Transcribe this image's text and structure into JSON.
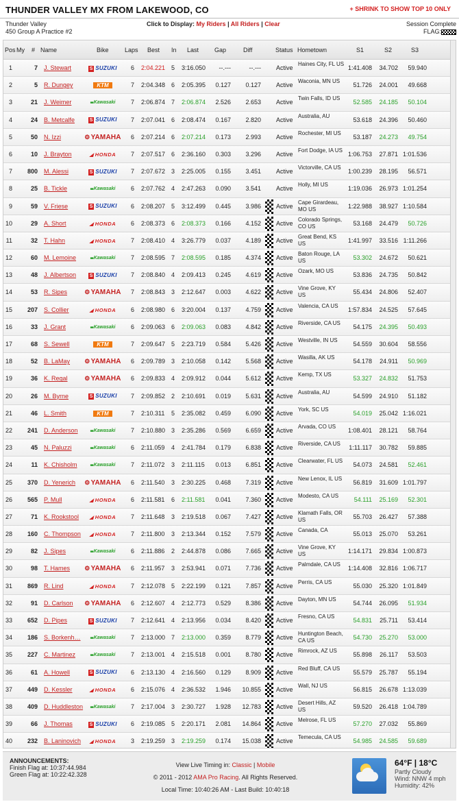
{
  "header": {
    "title": "THUNDER VALLEY MX FROM LAKEWOOD, CO",
    "shrink_label": "+ SHRINK TO SHOW TOP 10 ONLY"
  },
  "info": {
    "track": "Thunder Valley",
    "session_name": "450 Group A Practice #2",
    "display_prompt": "Click to Display:",
    "link_my_riders": "My Riders",
    "separator": " | ",
    "link_all_riders": "All Riders",
    "link_clear": "Clear",
    "session_status": "Session Complete",
    "flag_label": "FLAG:"
  },
  "columns": {
    "pos": "Pos",
    "my": "My",
    "num": "#",
    "name": "Name",
    "bike": "Bike",
    "laps": "Laps",
    "best": "Best",
    "in": "In",
    "last": "Last",
    "gap": "Gap",
    "diff": "Diff",
    "status": "Status",
    "hometown": "Hometown",
    "s1": "S1",
    "s2": "S2",
    "s3": "S3"
  },
  "colors": {
    "red": "#d32020",
    "green": "#2aa02a",
    "suzuki_blue": "#1a3fa8",
    "ktm_orange": "#f07a10"
  },
  "riders": [
    {
      "pos": "1",
      "num": "7",
      "name": "J. Stewart",
      "bike": "suzuki",
      "laps": "6",
      "best": "2:04.221",
      "in": "5",
      "last": "3:16.050",
      "gap": "--.---",
      "diff": "--.---",
      "status": "Active",
      "hometown": "Haines City, FL US",
      "s1": "1:41.408",
      "s2": "34.702",
      "s3": "59.940",
      "best_red": true
    },
    {
      "pos": "2",
      "num": "5",
      "name": "R. Dungey",
      "bike": "ktm",
      "laps": "7",
      "best": "2:04.348",
      "in": "6",
      "last": "2:05.395",
      "gap": "0.127",
      "diff": "0.127",
      "status": "Active",
      "hometown": "Waconia, MN US",
      "s1": "51.726",
      "s2": "24.001",
      "s3": "49.668"
    },
    {
      "pos": "3",
      "num": "21",
      "name": "J. Weimer",
      "bike": "kawasaki",
      "laps": "7",
      "best": "2:06.874",
      "in": "7",
      "last": "2:06.874",
      "gap": "2.526",
      "diff": "2.653",
      "status": "Active",
      "hometown": "Twin Falls, ID US",
      "s1": "52.585",
      "s2": "24.185",
      "s3": "50.104",
      "last_green": true,
      "s1g": true,
      "s2g": true,
      "s3g": true
    },
    {
      "pos": "4",
      "num": "24",
      "name": "B. Metcalfe",
      "bike": "suzuki",
      "laps": "7",
      "best": "2:07.041",
      "in": "6",
      "last": "2:08.474",
      "gap": "0.167",
      "diff": "2.820",
      "status": "Active",
      "hometown": "Australia, AU",
      "s1": "53.618",
      "s2": "24.396",
      "s3": "50.460"
    },
    {
      "pos": "5",
      "num": "50",
      "name": "N. Izzi",
      "bike": "yamaha",
      "laps": "6",
      "best": "2:07.214",
      "in": "6",
      "last": "2:07.214",
      "gap": "0.173",
      "diff": "2.993",
      "status": "Active",
      "hometown": "Rochester, MI US",
      "s1": "53.187",
      "s2": "24.273",
      "s3": "49.754",
      "last_green": true,
      "s2g": true,
      "s3g": true
    },
    {
      "pos": "6",
      "num": "10",
      "name": "J. Brayton",
      "bike": "honda",
      "laps": "7",
      "best": "2:07.517",
      "in": "6",
      "last": "2:36.160",
      "gap": "0.303",
      "diff": "3.296",
      "status": "Active",
      "hometown": "Fort Dodge, IA US",
      "s1": "1:06.753",
      "s2": "27.871",
      "s3": "1:01.536"
    },
    {
      "pos": "7",
      "num": "800",
      "name": "M. Alessi",
      "bike": "suzuki",
      "laps": "7",
      "best": "2:07.672",
      "in": "3",
      "last": "2:25.005",
      "gap": "0.155",
      "diff": "3.451",
      "status": "Active",
      "hometown": "Victorville, CA US",
      "s1": "1:00.239",
      "s2": "28.195",
      "s3": "56.571"
    },
    {
      "pos": "8",
      "num": "25",
      "name": "B. Tickle",
      "bike": "kawasaki",
      "laps": "6",
      "best": "2:07.762",
      "in": "4",
      "last": "2:47.263",
      "gap": "0.090",
      "diff": "3.541",
      "status": "Active",
      "hometown": "Holly, MI US",
      "s1": "1:19.036",
      "s2": "26.973",
      "s3": "1:01.254"
    },
    {
      "pos": "9",
      "num": "59",
      "name": "V. Friese",
      "bike": "suzuki",
      "laps": "6",
      "best": "2:08.207",
      "in": "5",
      "last": "3:12.499",
      "gap": "0.445",
      "diff": "3.986",
      "status": "Active",
      "hometown": "Cape Girardeau, MO US",
      "s1": "1:22.988",
      "s2": "38.927",
      "s3": "1:10.584",
      "chk": true
    },
    {
      "pos": "10",
      "num": "29",
      "name": "A. Short",
      "bike": "honda",
      "laps": "6",
      "best": "2:08.373",
      "in": "6",
      "last": "2:08.373",
      "gap": "0.166",
      "diff": "4.152",
      "status": "Active",
      "hometown": "Colorado Springs, CO US",
      "s1": "53.168",
      "s2": "24.479",
      "s3": "50.726",
      "last_green": true,
      "s3g": true,
      "chk": true
    },
    {
      "pos": "11",
      "num": "32",
      "name": "T. Hahn",
      "bike": "honda",
      "laps": "7",
      "best": "2:08.410",
      "in": "4",
      "last": "3:26.779",
      "gap": "0.037",
      "diff": "4.189",
      "status": "Active",
      "hometown": "Great Bend, KS US",
      "s1": "1:41.997",
      "s2": "33.516",
      "s3": "1:11.266",
      "chk": true
    },
    {
      "pos": "12",
      "num": "60",
      "name": "M. Lemoine",
      "bike": "kawasaki",
      "laps": "7",
      "best": "2:08.595",
      "in": "7",
      "last": "2:08.595",
      "gap": "0.185",
      "diff": "4.374",
      "status": "Active",
      "hometown": "Baton Rouge, LA US",
      "s1": "53.302",
      "s2": "24.672",
      "s3": "50.621",
      "last_green": true,
      "s1g": true,
      "chk": true
    },
    {
      "pos": "13",
      "num": "48",
      "name": "J. Albertson",
      "bike": "suzuki",
      "laps": "7",
      "best": "2:08.840",
      "in": "4",
      "last": "2:09.413",
      "gap": "0.245",
      "diff": "4.619",
      "status": "Active",
      "hometown": "Ozark, MO US",
      "s1": "53.836",
      "s2": "24.735",
      "s3": "50.842",
      "chk": true
    },
    {
      "pos": "14",
      "num": "53",
      "name": "R. Sipes",
      "bike": "yamaha",
      "laps": "7",
      "best": "2:08.843",
      "in": "3",
      "last": "2:12.647",
      "gap": "0.003",
      "diff": "4.622",
      "status": "Active",
      "hometown": "Vine Grove, KY US",
      "s1": "55.434",
      "s2": "24.806",
      "s3": "52.407",
      "chk": true
    },
    {
      "pos": "15",
      "num": "207",
      "name": "S. Collier",
      "bike": "honda",
      "laps": "6",
      "best": "2:08.980",
      "in": "6",
      "last": "3:20.004",
      "gap": "0.137",
      "diff": "4.759",
      "status": "Active",
      "hometown": "Valencia, CA US",
      "s1": "1:57.834",
      "s2": "24.525",
      "s3": "57.645",
      "chk": true
    },
    {
      "pos": "16",
      "num": "33",
      "name": "J. Grant",
      "bike": "kawasaki",
      "laps": "6",
      "best": "2:09.063",
      "in": "6",
      "last": "2:09.063",
      "gap": "0.083",
      "diff": "4.842",
      "status": "Active",
      "hometown": "Riverside, CA US",
      "s1": "54.175",
      "s2": "24.395",
      "s3": "50.493",
      "last_green": true,
      "s2g": true,
      "s3g": true,
      "chk": true
    },
    {
      "pos": "17",
      "num": "68",
      "name": "S. Sewell",
      "bike": "ktm",
      "laps": "7",
      "best": "2:09.647",
      "in": "5",
      "last": "2:23.719",
      "gap": "0.584",
      "diff": "5.426",
      "status": "Active",
      "hometown": "Westville, IN US",
      "s1": "54.559",
      "s2": "30.604",
      "s3": "58.556",
      "chk": true
    },
    {
      "pos": "18",
      "num": "52",
      "name": "B. LaMay",
      "bike": "yamaha",
      "laps": "6",
      "best": "2:09.789",
      "in": "3",
      "last": "2:10.058",
      "gap": "0.142",
      "diff": "5.568",
      "status": "Active",
      "hometown": "Wasilla, AK US",
      "s1": "54.178",
      "s2": "24.911",
      "s3": "50.969",
      "s3g": true,
      "chk": true
    },
    {
      "pos": "19",
      "num": "36",
      "name": "K. Regal",
      "bike": "yamaha",
      "laps": "6",
      "best": "2:09.833",
      "in": "4",
      "last": "2:09.912",
      "gap": "0.044",
      "diff": "5.612",
      "status": "Active",
      "hometown": "Kemp, TX US",
      "s1": "53.327",
      "s2": "24.832",
      "s3": "51.753",
      "s1g": true,
      "s2g": true,
      "chk": true
    },
    {
      "pos": "20",
      "num": "26",
      "name": "M. Byrne",
      "bike": "suzuki",
      "laps": "7",
      "best": "2:09.852",
      "in": "2",
      "last": "2:10.691",
      "gap": "0.019",
      "diff": "5.631",
      "status": "Active",
      "hometown": "Australia, AU",
      "s1": "54.599",
      "s2": "24.910",
      "s3": "51.182",
      "chk": true
    },
    {
      "pos": "21",
      "num": "46",
      "name": "L. Smith",
      "bike": "ktm",
      "laps": "7",
      "best": "2:10.311",
      "in": "5",
      "last": "2:35.082",
      "gap": "0.459",
      "diff": "6.090",
      "status": "Active",
      "hometown": "York, SC US",
      "s1": "54.019",
      "s2": "25.042",
      "s3": "1:16.021",
      "s1g": true,
      "chk": true
    },
    {
      "pos": "22",
      "num": "241",
      "name": "D. Anderson",
      "bike": "kawasaki",
      "laps": "7",
      "best": "2:10.880",
      "in": "3",
      "last": "2:35.286",
      "gap": "0.569",
      "diff": "6.659",
      "status": "Active",
      "hometown": "Arvada, CO US",
      "s1": "1:08.401",
      "s2": "28.121",
      "s3": "58.764",
      "chk": true
    },
    {
      "pos": "23",
      "num": "45",
      "name": "N. Paluzzi",
      "bike": "kawasaki",
      "laps": "6",
      "best": "2:11.059",
      "in": "4",
      "last": "2:41.784",
      "gap": "0.179",
      "diff": "6.838",
      "status": "Active",
      "hometown": "Riverside, CA US",
      "s1": "1:11.117",
      "s2": "30.782",
      "s3": "59.885",
      "chk": true
    },
    {
      "pos": "24",
      "num": "11",
      "name": "K. Chisholm",
      "bike": "kawasaki",
      "laps": "7",
      "best": "2:11.072",
      "in": "3",
      "last": "2:11.115",
      "gap": "0.013",
      "diff": "6.851",
      "status": "Active",
      "hometown": "Clearwater, FL US",
      "s1": "54.073",
      "s2": "24.581",
      "s3": "52.461",
      "s3g": true,
      "chk": true
    },
    {
      "pos": "25",
      "num": "370",
      "name": "D. Yenerich",
      "bike": "yamaha",
      "laps": "6",
      "best": "2:11.540",
      "in": "3",
      "last": "2:30.225",
      "gap": "0.468",
      "diff": "7.319",
      "status": "Active",
      "hometown": "New Lenox, IL US",
      "s1": "56.819",
      "s2": "31.609",
      "s3": "1:01.797",
      "chk": true
    },
    {
      "pos": "26",
      "num": "565",
      "name": "P. Mull",
      "bike": "honda",
      "laps": "6",
      "best": "2:11.581",
      "in": "6",
      "last": "2:11.581",
      "gap": "0.041",
      "diff": "7.360",
      "status": "Active",
      "hometown": "Modesto, CA US",
      "s1": "54.111",
      "s2": "25.169",
      "s3": "52.301",
      "last_green": true,
      "s1g": true,
      "s2g": true,
      "s3g": true,
      "chk": true
    },
    {
      "pos": "27",
      "num": "71",
      "name": "K. Rookstool",
      "bike": "honda",
      "laps": "7",
      "best": "2:11.648",
      "in": "3",
      "last": "2:19.518",
      "gap": "0.067",
      "diff": "7.427",
      "status": "Active",
      "hometown": "Klamath Falls, OR US",
      "s1": "55.703",
      "s2": "26.427",
      "s3": "57.388",
      "chk": true
    },
    {
      "pos": "28",
      "num": "160",
      "name": "C. Thompson",
      "bike": "honda",
      "laps": "7",
      "best": "2:11.800",
      "in": "3",
      "last": "2:13.344",
      "gap": "0.152",
      "diff": "7.579",
      "status": "Active",
      "hometown": "Canada, CA",
      "s1": "55.013",
      "s2": "25.070",
      "s3": "53.261",
      "chk": true
    },
    {
      "pos": "29",
      "num": "82",
      "name": "J. Sipes",
      "bike": "kawasaki",
      "laps": "6",
      "best": "2:11.886",
      "in": "2",
      "last": "2:44.878",
      "gap": "0.086",
      "diff": "7.665",
      "status": "Active",
      "hometown": "Vine Grove, KY US",
      "s1": "1:14.171",
      "s2": "29.834",
      "s3": "1:00.873",
      "chk": true
    },
    {
      "pos": "30",
      "num": "98",
      "name": "T. Hames",
      "bike": "yamaha",
      "laps": "6",
      "best": "2:11.957",
      "in": "3",
      "last": "2:53.941",
      "gap": "0.071",
      "diff": "7.736",
      "status": "Active",
      "hometown": "Palmdale, CA US",
      "s1": "1:14.408",
      "s2": "32.816",
      "s3": "1:06.717",
      "chk": true
    },
    {
      "pos": "31",
      "num": "869",
      "name": "R. Lind",
      "bike": "honda",
      "laps": "7",
      "best": "2:12.078",
      "in": "5",
      "last": "2:22.199",
      "gap": "0.121",
      "diff": "7.857",
      "status": "Active",
      "hometown": "Perris, CA US",
      "s1": "55.030",
      "s2": "25.320",
      "s3": "1:01.849",
      "chk": true
    },
    {
      "pos": "32",
      "num": "91",
      "name": "D. Carlson",
      "bike": "yamaha",
      "laps": "6",
      "best": "2:12.607",
      "in": "4",
      "last": "2:12.773",
      "gap": "0.529",
      "diff": "8.386",
      "status": "Active",
      "hometown": "Dayton, MN US",
      "s1": "54.744",
      "s2": "26.095",
      "s3": "51.934",
      "s3g": true,
      "chk": true
    },
    {
      "pos": "33",
      "num": "652",
      "name": "D. Pipes",
      "bike": "suzuki",
      "laps": "7",
      "best": "2:12.641",
      "in": "4",
      "last": "2:13.956",
      "gap": "0.034",
      "diff": "8.420",
      "status": "Active",
      "hometown": "Fresno, CA US",
      "s1": "54.831",
      "s2": "25.711",
      "s3": "53.414",
      "s1g": true,
      "chk": true
    },
    {
      "pos": "34",
      "num": "186",
      "name": "S. Borkenh…",
      "bike": "kawasaki",
      "laps": "7",
      "best": "2:13.000",
      "in": "7",
      "last": "2:13.000",
      "gap": "0.359",
      "diff": "8.779",
      "status": "Active",
      "hometown": "Huntington Beach, CA US",
      "s1": "54.730",
      "s2": "25.270",
      "s3": "53.000",
      "last_green": true,
      "s1g": true,
      "s2g": true,
      "s3g": true,
      "chk": true
    },
    {
      "pos": "35",
      "num": "227",
      "name": "C. Martinez",
      "bike": "kawasaki",
      "laps": "7",
      "best": "2:13.001",
      "in": "4",
      "last": "2:15.518",
      "gap": "0.001",
      "diff": "8.780",
      "status": "Active",
      "hometown": "Rimrock, AZ US",
      "s1": "55.898",
      "s2": "26.117",
      "s3": "53.503",
      "chk": true
    },
    {
      "pos": "36",
      "num": "61",
      "name": "A. Howell",
      "bike": "suzuki",
      "laps": "6",
      "best": "2:13.130",
      "in": "4",
      "last": "2:16.560",
      "gap": "0.129",
      "diff": "8.909",
      "status": "Active",
      "hometown": "Red Bluff, CA US",
      "s1": "55.579",
      "s2": "25.787",
      "s3": "55.194",
      "chk": true
    },
    {
      "pos": "37",
      "num": "449",
      "name": "D. Kessler",
      "bike": "honda",
      "laps": "6",
      "best": "2:15.076",
      "in": "4",
      "last": "2:36.532",
      "gap": "1.946",
      "diff": "10.855",
      "status": "Active",
      "hometown": "Wall, NJ US",
      "s1": "56.815",
      "s2": "26.678",
      "s3": "1:13.039",
      "chk": true
    },
    {
      "pos": "38",
      "num": "409",
      "name": "D. Huddleston",
      "bike": "kawasaki",
      "laps": "7",
      "best": "2:17.004",
      "in": "3",
      "last": "2:30.727",
      "gap": "1.928",
      "diff": "12.783",
      "status": "Active",
      "hometown": "Desert Hills, AZ US",
      "s1": "59.520",
      "s2": "26.418",
      "s3": "1:04.789",
      "chk": true
    },
    {
      "pos": "39",
      "num": "66",
      "name": "J. Thomas",
      "bike": "suzuki",
      "laps": "6",
      "best": "2:19.085",
      "in": "5",
      "last": "2:20.171",
      "gap": "2.081",
      "diff": "14.864",
      "status": "Active",
      "hometown": "Melrose, FL US",
      "s1": "57.270",
      "s2": "27.032",
      "s3": "55.869",
      "s1g": true,
      "chk": true
    },
    {
      "pos": "40",
      "num": "232",
      "name": "B. Laninovich",
      "bike": "honda",
      "laps": "3",
      "best": "2:19.259",
      "in": "3",
      "last": "2:19.259",
      "gap": "0.174",
      "diff": "15.038",
      "status": "Active",
      "hometown": "Temecula, CA US",
      "s1": "54.985",
      "s2": "24.585",
      "s3": "59.689",
      "last_green": true,
      "s1g": true,
      "s2g": true,
      "s3g": true,
      "chk": true
    }
  ],
  "bikes": {
    "suzuki": "SUZUKI",
    "kawasaki": "Kawasaki",
    "ktm": "KTM",
    "yamaha": "YAMAHA",
    "honda": "HONDA"
  },
  "footer": {
    "announcements_title": "ANNOUNCEMENTS:",
    "finish_flag": "Finish Flag at: 10:37:44.984",
    "green_flag": "Green Flag at: 10:22:42.328",
    "live_timing_prefix": "View Live Timing in: ",
    "link_classic": "Classic",
    "link_sep": " | ",
    "link_mobile": "Mobile",
    "copyright_prefix": "© 2011 - 2012 ",
    "link_ama": "AMA Pro Racing",
    "copyright_suffix": ". All Rights Reserved.",
    "local_time": "Local Time: 10:40:26 AM - Last Build: 10:40:18",
    "weather_icon": "partly-cloudy-icon",
    "temperature": "64°F | 18°C",
    "conditions": "Partly Cloudy",
    "wind": "Wind: NNW 4 mph",
    "humidity": "Humidity: 42%"
  }
}
